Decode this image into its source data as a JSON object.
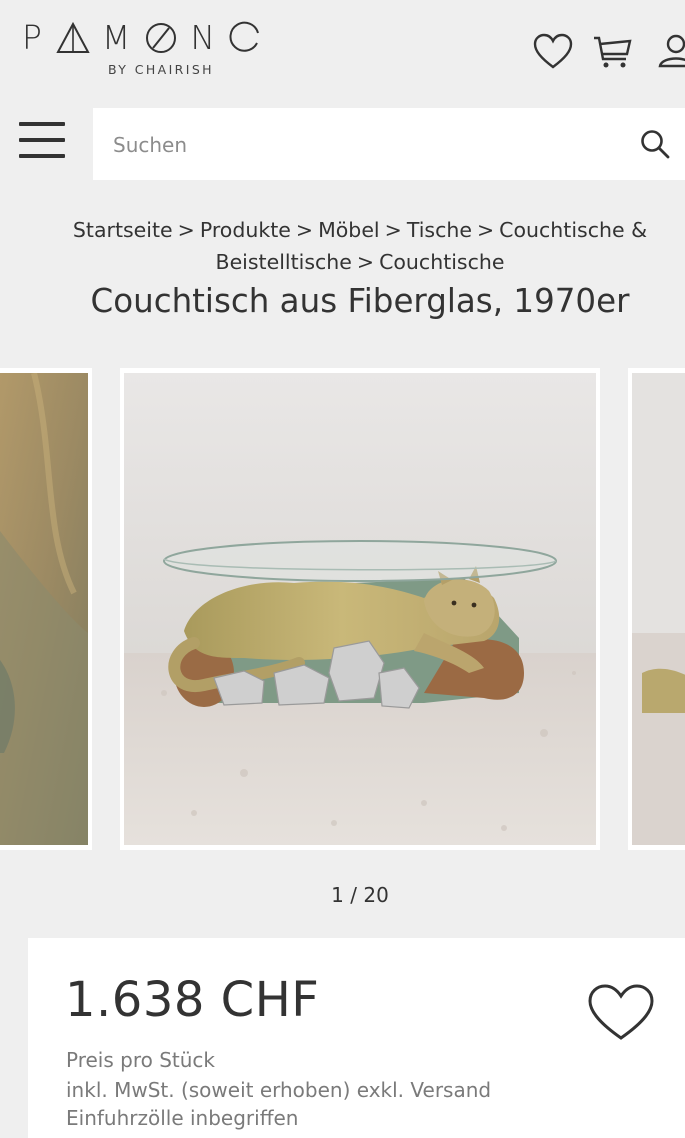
{
  "header": {
    "logo": {
      "letters": [
        "P",
        "M",
        "N"
      ],
      "subtitle": "BY CHAIRISH"
    },
    "icons": [
      "heart-icon",
      "cart-icon",
      "user-icon"
    ]
  },
  "search": {
    "placeholder": "Suchen"
  },
  "breadcrumb": {
    "items": [
      "Startseite",
      "Produkte",
      "Möbel",
      "Tische",
      "Couchtische &",
      "Beistelltische",
      "Couchtische"
    ],
    "separator": ">"
  },
  "product": {
    "title": "Couchtisch aus Fiberglas, 1970er",
    "gallery": {
      "counter": "1 / 20"
    },
    "price": "1.638 CHF",
    "price_unit": "Preis pro Stück",
    "tax_note": "inkl. MwSt. (soweit erhoben) exkl. Versand",
    "duty_note": "Einfuhrzölle inbegriffen"
  },
  "colors": {
    "background": "#efefef",
    "text": "#333333",
    "muted_text": "#7a7a7a",
    "card": "#ffffff"
  }
}
